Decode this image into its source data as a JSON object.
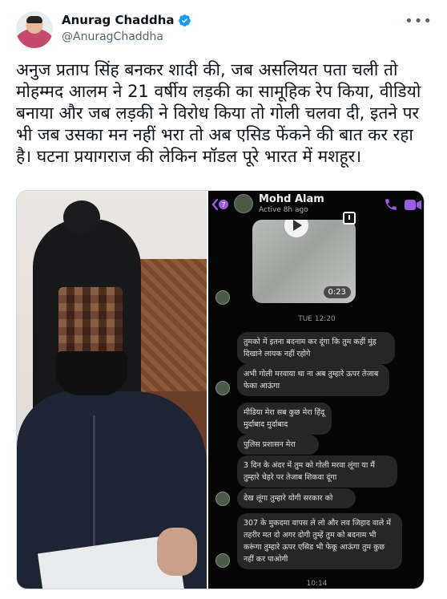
{
  "tweet": {
    "author": {
      "display_name": "Anurag Chaddha",
      "handle": "@AnuragChaddha",
      "verified": true
    },
    "more_icon": "more-icon",
    "text": "अनुज प्रताप सिंह बनकर शादी की, जब असलियत पता चली तो मोहम्मद आलम ने 21 वर्षीय लड़की का सामूहिक रेप किया, वीडियो बनाया और जब लड़की ने विरोध किया तो गोली चलवा दी, इतने पर भी जब उसका मन नहीं भरा तो अब एसिड फेंकने की बात कर रहा है। घटना प्रयागराज की लेकिन मॉडल पूरे भारत में मशहूर।"
  },
  "chat": {
    "back_badge": "7",
    "contact_name": "Mohd Alam",
    "status": "Active 8h ago",
    "video_duration": "0:23",
    "time_separator_1": "TUE 12:20",
    "time_separator_2": "10:14",
    "messages": [
      "तुमको में इतना बदनाम कर दूंगा कि तुम कहीं मुंह दिखाने लायक नहीं रहोगे",
      "अभी गोली मरवाया था ना अब तुम्हारे ऊपर तेजाब फेका आऊंगा",
      "मीडिया मेरा सब कुछ मेरा हिंदू मुर्दाबाद मुर्दाबाद",
      "पुलिस प्रशासन मेरा",
      "3 दिन के अंदर में तुम को गोली मरवा लूंगा या मैं तुम्हारे चेहरे पर तेजाब शिकवा दूंगा",
      "देख लूंगा तुम्हारे योगी सरकार को",
      "307 के मुकदमा वापस ले लो और लव जिहाद वाले में तहरीर मत दो अगर दोगी तुम्हें तुम को बदनाम भी करूंगा तुम्हारे ऊपर एसिड भी फेकू आऊंगा तुम कुछ नहीं कर पाओगी"
    ]
  },
  "colors": {
    "verified_blue": "#1d9bf0",
    "text_primary": "#0f1419",
    "text_secondary": "#536471",
    "messenger_purple": "#9b5de5"
  }
}
